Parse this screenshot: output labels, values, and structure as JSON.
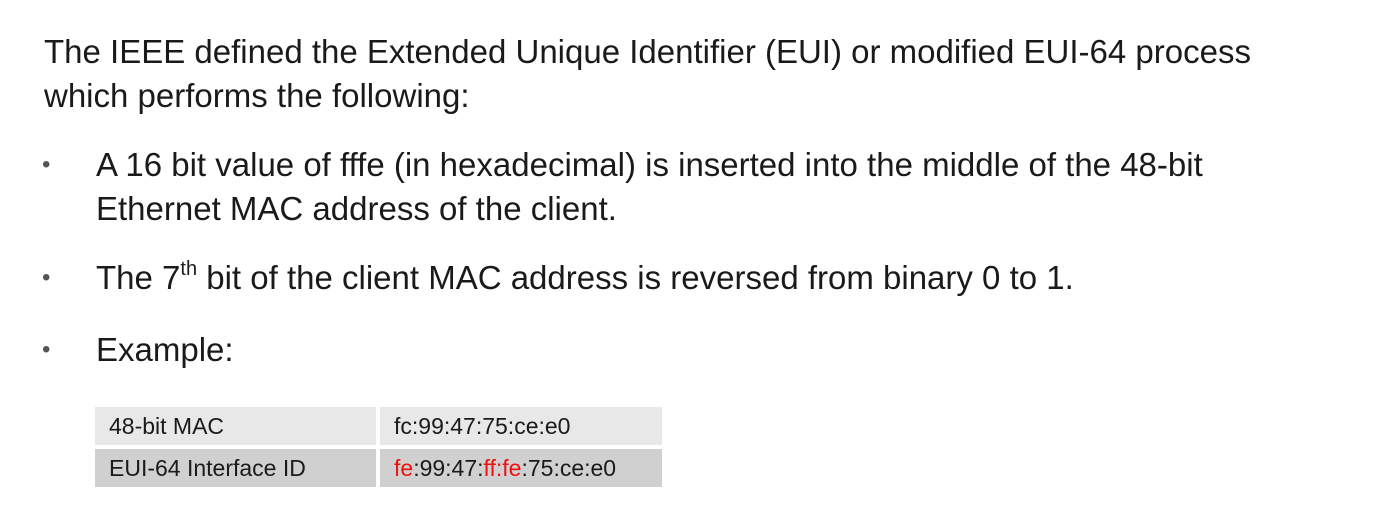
{
  "intro": {
    "line1": "The IEEE defined the Extended Unique Identifier (EUI) or modified EUI-64 process",
    "line2": "which performs the following:"
  },
  "bullets": [
    {
      "marker": "•",
      "line1": "A 16 bit value of fffe (in hexadecimal) is inserted into the middle of the 48-bit",
      "line2": "Ethernet MAC address of the client."
    },
    {
      "marker": "•",
      "before": "The 7",
      "superscript": "th",
      "after": " bit of the client MAC address is reversed from binary 0 to 1."
    },
    {
      "marker": "•",
      "text": "Example:"
    }
  ],
  "example_table": {
    "rows": [
      {
        "label": "48-bit MAC",
        "value": "fc:99:47:75:ce:e0"
      },
      {
        "label": "EUI-64 Interface ID",
        "value_parts": {
          "first_byte": "fe",
          "middle": ":99:47:",
          "inserted": "ff:fe",
          "rest": ":75:ce:e0"
        }
      }
    ]
  },
  "colors": {
    "text": "#1a1a1a",
    "highlight": "#ee1111",
    "row_light": "#e8e8e8",
    "row_dark": "#d0d0d0"
  }
}
